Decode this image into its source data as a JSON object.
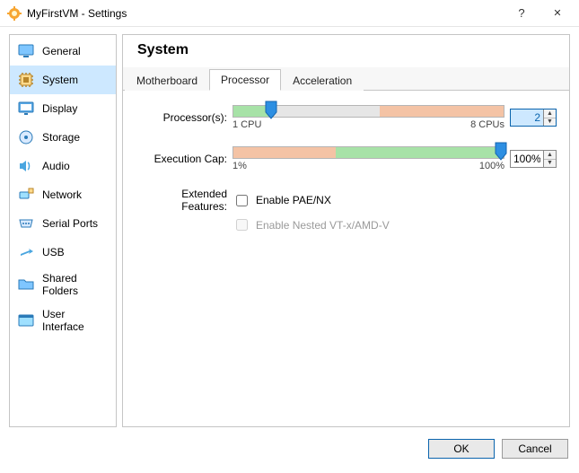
{
  "window": {
    "title": "MyFirstVM - Settings",
    "help_glyph": "?",
    "close_glyph": "✕"
  },
  "sidebar": {
    "items": [
      {
        "label": "General"
      },
      {
        "label": "System"
      },
      {
        "label": "Display"
      },
      {
        "label": "Storage"
      },
      {
        "label": "Audio"
      },
      {
        "label": "Network"
      },
      {
        "label": "Serial Ports"
      },
      {
        "label": "USB"
      },
      {
        "label": "Shared Folders"
      },
      {
        "label": "User Interface"
      }
    ],
    "selected_index": 1
  },
  "page": {
    "title": "System",
    "tabs": [
      {
        "label": "Motherboard"
      },
      {
        "label": "Processor"
      },
      {
        "label": "Acceleration"
      }
    ],
    "active_tab": 1,
    "processor": {
      "label": "Processor(s):",
      "min_label": "1 CPU",
      "max_label": "8 CPUs",
      "value": "2"
    },
    "exec_cap": {
      "label": "Execution Cap:",
      "min_label": "1%",
      "max_label": "100%",
      "value": "100%"
    },
    "extended": {
      "label": "Extended Features:",
      "pae_label": "Enable PAE/NX",
      "nested_label": "Enable Nested VT-x/AMD-V"
    }
  },
  "footer": {
    "ok": "OK",
    "cancel": "Cancel"
  }
}
